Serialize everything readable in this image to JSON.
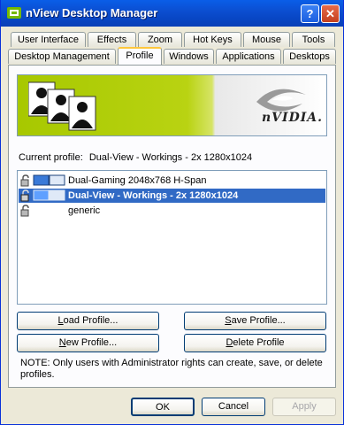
{
  "window": {
    "title": "nView Desktop Manager",
    "help_button": "?",
    "close_button": "✕"
  },
  "tabs_back": [
    "User Interface",
    "Effects",
    "Zoom",
    "Hot Keys",
    "Mouse",
    "Tools"
  ],
  "tabs_front": [
    "Desktop Management",
    "Profile",
    "Windows",
    "Applications",
    "Desktops"
  ],
  "active_tab": "Profile",
  "banner": {
    "logo_text": "nVIDIA."
  },
  "current_profile": {
    "label": "Current profile:",
    "value": "Dual-View - Workings - 2x 1280x1024"
  },
  "profiles": [
    {
      "label": "Dual-Gaming 2048x768 H-Span",
      "selected": false,
      "icons": [
        "lock-icon",
        "dual-monitor-icon"
      ]
    },
    {
      "label": "Dual-View - Workings - 2x 1280x1024",
      "selected": true,
      "icons": [
        "lock-icon",
        "dual-monitor-icon"
      ]
    },
    {
      "label": "generic",
      "selected": false,
      "icons": [
        "lock-icon"
      ]
    }
  ],
  "buttons": {
    "load": {
      "key": "L",
      "rest": "oad Profile..."
    },
    "save": {
      "key": "S",
      "rest": "ave Profile..."
    },
    "new": {
      "key": "N",
      "rest": "ew Profile..."
    },
    "delete": {
      "key": "D",
      "rest": "elete Profile"
    }
  },
  "note": "NOTE: Only users with Administrator rights can create, save, or delete profiles.",
  "dialog": {
    "ok": "OK",
    "cancel": "Cancel",
    "apply": "Apply"
  },
  "colors": {
    "titlebar": "#0a5ee8",
    "selection": "#316ac5",
    "banner_green": "#a7c800",
    "tab_highlight": "#ffc73c"
  }
}
